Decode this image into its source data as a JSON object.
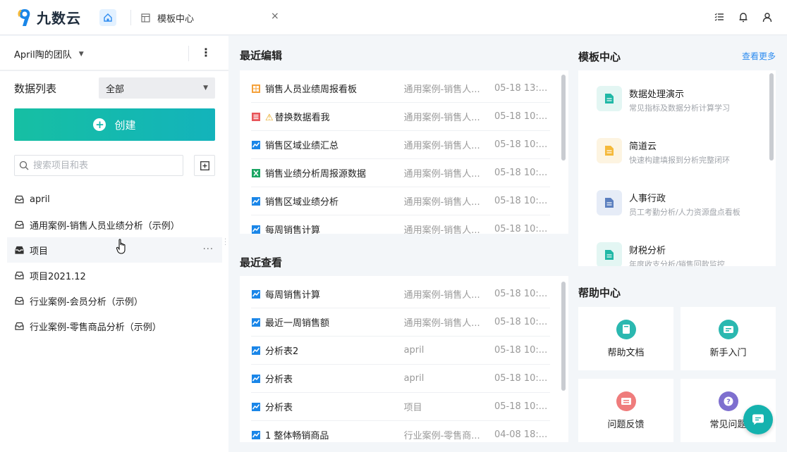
{
  "app": {
    "brand": "九数云"
  },
  "tabs": [
    {
      "label": "模板中心"
    }
  ],
  "sidebar": {
    "team": "April陶的团队",
    "list_label": "数据列表",
    "filter": "全部",
    "create_label": "创建",
    "search_placeholder": "搜索项目和表",
    "projects": [
      {
        "label": "april"
      },
      {
        "label": "通用案例-销售人员业绩分析（示例）"
      },
      {
        "label": "项目"
      },
      {
        "label": "项目2021.12"
      },
      {
        "label": "行业案例-会员分析（示例）"
      },
      {
        "label": "行业案例-零售商品分析（示例）"
      }
    ]
  },
  "recent_edit": {
    "title": "最近编辑",
    "rows": [
      {
        "icon": "dashboard-icon",
        "name": "销售人员业绩周报看板",
        "folder": "通用案例-销售人...",
        "time": "05-18 13:..."
      },
      {
        "icon": "report-icon",
        "name": "替换数据看我",
        "warn": "⚠",
        "folder": "通用案例-销售人...",
        "time": "05-18 10:..."
      },
      {
        "icon": "chart-icon",
        "name": "销售区域业绩汇总",
        "folder": "通用案例-销售人...",
        "time": "05-18 10:..."
      },
      {
        "icon": "excel-icon",
        "name": "销售业绩分析周报源数据",
        "folder": "通用案例-销售人...",
        "time": "05-18 10:..."
      },
      {
        "icon": "chart-icon",
        "name": "销售区域业绩分析",
        "folder": "通用案例-销售人...",
        "time": "05-18 10:..."
      },
      {
        "icon": "chart-icon",
        "name": "每周销售计算",
        "folder": "通用案例-销售人...",
        "time": "05-18 10:..."
      }
    ]
  },
  "recent_view": {
    "title": "最近查看",
    "rows": [
      {
        "icon": "chart-icon",
        "name": "每周销售计算",
        "folder": "通用案例-销售人...",
        "time": "05-18 10:..."
      },
      {
        "icon": "chart-icon",
        "name": "最近一周销售额",
        "folder": "通用案例-销售人...",
        "time": "05-18 10:..."
      },
      {
        "icon": "chart-icon",
        "name": "分析表2",
        "folder": "april",
        "time": "05-18 10:..."
      },
      {
        "icon": "chart-icon",
        "name": "分析表",
        "folder": "april",
        "time": "05-18 10:..."
      },
      {
        "icon": "chart-icon",
        "name": "分析表",
        "folder": "项目",
        "time": "05-18 10:..."
      },
      {
        "icon": "chart-icon",
        "name": "1 整体畅销商品",
        "folder": "行业案例-零售商...",
        "time": "04-08 18:..."
      }
    ]
  },
  "templates": {
    "title": "模板中心",
    "see_more": "查看更多",
    "items": [
      {
        "name": "数据处理演示",
        "desc": "常见指标及数据分析计算学习",
        "color": "#1fb8a6",
        "bg": "#e3f6f3"
      },
      {
        "name": "简道云",
        "desc": "快速构建填报到分析完整闭环",
        "color": "#f5b93a",
        "bg": "#fdf4e1"
      },
      {
        "name": "人事行政",
        "desc": "员工考勤分析/人力资源盘点看板",
        "color": "#5b7fbf",
        "bg": "#e6ecf7"
      },
      {
        "name": "财税分析",
        "desc": "年度收支分析/销售回款监控",
        "color": "#1fb8a6",
        "bg": "#e3f6f3"
      }
    ]
  },
  "help": {
    "title": "帮助中心",
    "items": [
      {
        "label": "帮助文档",
        "color": "#2bb8b0"
      },
      {
        "label": "新手入门",
        "color": "#2bb8b0"
      },
      {
        "label": "问题反馈",
        "color": "#ef7c7c"
      },
      {
        "label": "常见问题",
        "color": "#7e6fcf"
      }
    ]
  }
}
